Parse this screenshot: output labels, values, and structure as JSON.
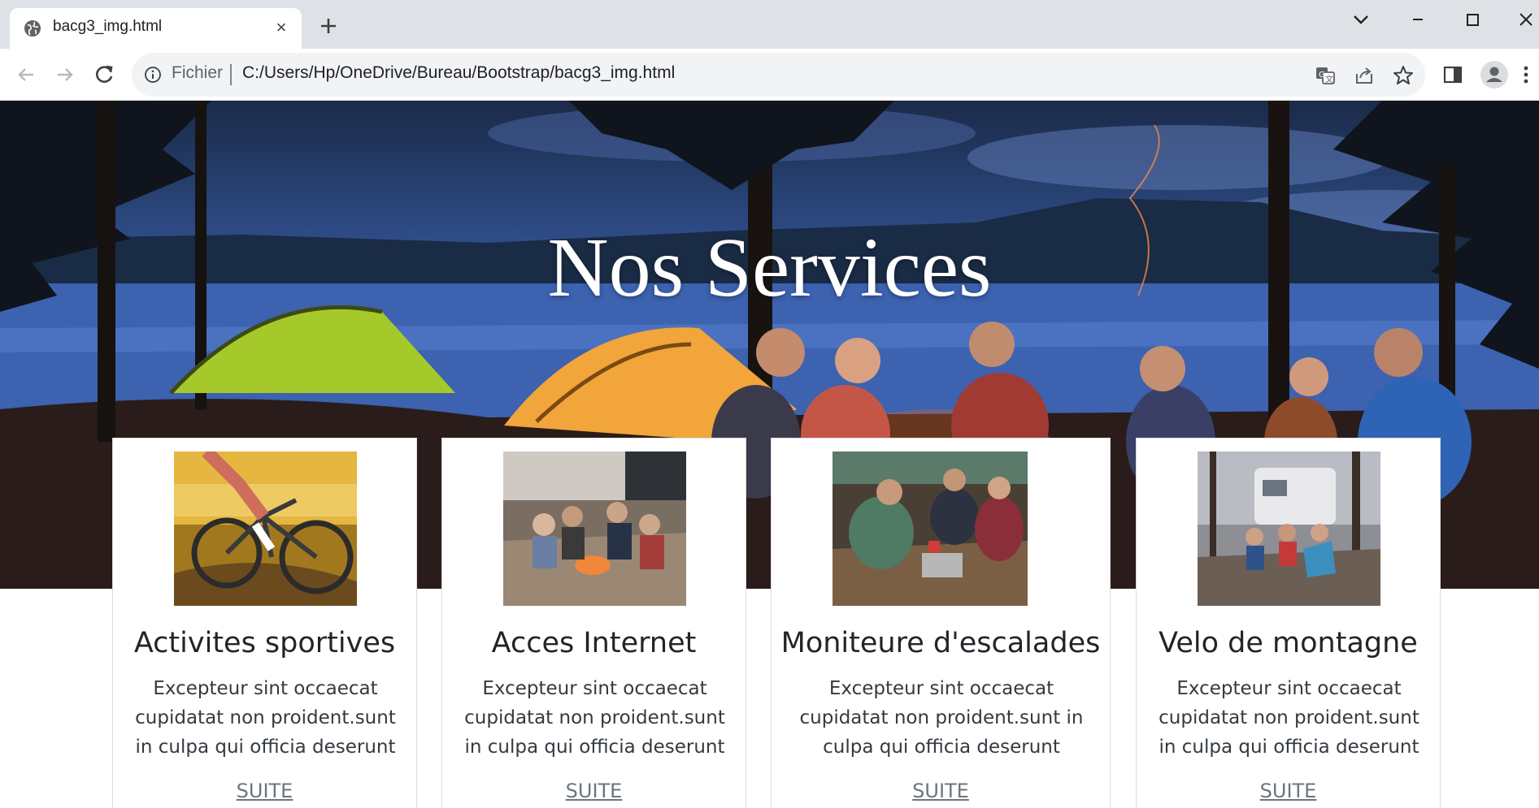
{
  "browser": {
    "tab": {
      "title": "bacg3_img.html",
      "close_glyph": "×",
      "icon": "globe-icon"
    },
    "address_bar": {
      "scheme_label": "Fichier",
      "url": "C:/Users/Hp/OneDrive/Bureau/Bootstrap/bacg3_img.html"
    },
    "colors": {
      "tabbar_bg": "#dee1e6",
      "omnibox_bg": "#f1f3f4"
    }
  },
  "hero": {
    "title": "Nos Services"
  },
  "cards": [
    {
      "title": "Activites sportives",
      "text": "Excepteur sint occaecat cupidatat non proident.sunt in culpa qui officia deserunt",
      "link": "SUITE",
      "image": "mountain-bike-photo"
    },
    {
      "title": "Acces Internet",
      "text": "Excepteur sint occaecat cupidatat non proident.sunt in culpa qui officia deserunt",
      "link": "SUITE",
      "image": "campfire-group-photo"
    },
    {
      "title": "Moniteure d'escalades",
      "text": "Excepteur sint occaecat cupidatat non proident.sunt in culpa qui officia deserunt",
      "link": "SUITE",
      "image": "camp-cooking-photo"
    },
    {
      "title": "Velo de montagne",
      "text": "Excepteur sint occaecat cupidatat non proident.sunt in culpa qui officia deserunt",
      "link": "SUITE",
      "image": "rv-campsite-photo"
    }
  ]
}
